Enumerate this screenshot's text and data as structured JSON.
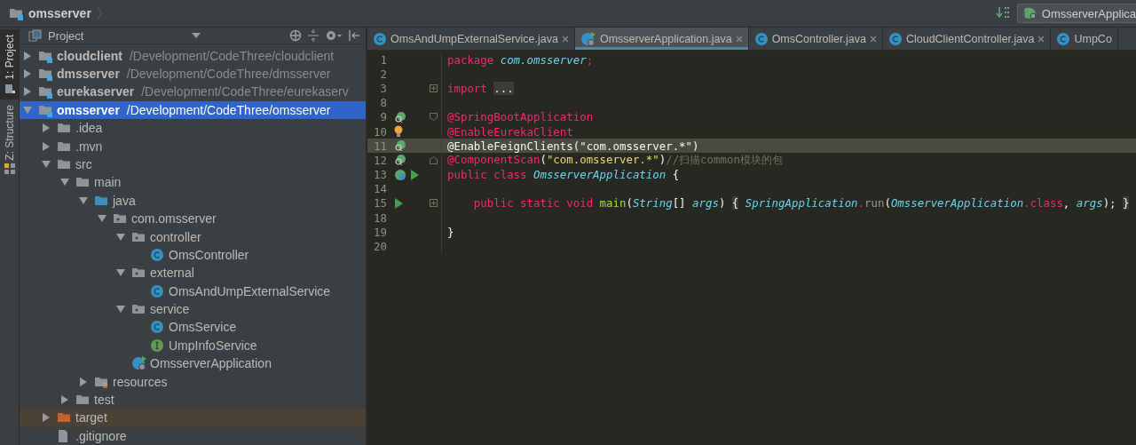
{
  "breadcrumb": {
    "label": "omsserver"
  },
  "toolbar": {
    "run_config": "OmsserverApplica"
  },
  "tool_strip": [
    {
      "label": "1: Project",
      "selected": true
    },
    {
      "label": "Z: Structure",
      "selected": false
    }
  ],
  "project_panel": {
    "title": "Project",
    "tree": [
      {
        "name": "cloudclient",
        "path": "/Development/CodeThree/cloudclient",
        "kind": "module",
        "expanded": false,
        "selected": false,
        "hovered": false
      },
      {
        "name": "dmsserver",
        "path": "/Development/CodeThree/dmsserver",
        "kind": "module",
        "expanded": false,
        "selected": false,
        "hovered": false
      },
      {
        "name": "eurekaserver",
        "path": "/Development/CodeThree/eurekaserv",
        "kind": "module",
        "expanded": false,
        "selected": false,
        "hovered": false
      },
      {
        "name": "omsserver",
        "path": "/Development/CodeThree/omsserver",
        "kind": "module",
        "expanded": true,
        "selected": true,
        "hovered": false,
        "children": [
          {
            "name": ".idea",
            "kind": "folder",
            "expanded": false,
            "selected": false,
            "hovered": false
          },
          {
            "name": ".mvn",
            "kind": "folder",
            "expanded": false,
            "selected": false,
            "hovered": false
          },
          {
            "name": "src",
            "kind": "folder",
            "expanded": true,
            "selected": false,
            "hovered": false,
            "children": [
              {
                "name": "main",
                "kind": "folder",
                "expanded": true,
                "selected": false,
                "hovered": false,
                "children": [
                  {
                    "name": "java",
                    "kind": "source",
                    "expanded": true,
                    "selected": false,
                    "hovered": false,
                    "children": [
                      {
                        "name": "com.omsserver",
                        "kind": "package",
                        "expanded": true,
                        "selected": false,
                        "hovered": false,
                        "children": [
                          {
                            "name": "controller",
                            "kind": "package",
                            "expanded": true,
                            "selected": false,
                            "hovered": false,
                            "children": [
                              {
                                "name": "OmsController",
                                "kind": "class",
                                "selected": false,
                                "hovered": false
                              }
                            ]
                          },
                          {
                            "name": "external",
                            "kind": "package",
                            "expanded": true,
                            "selected": false,
                            "hovered": false,
                            "children": [
                              {
                                "name": "OmsAndUmpExternalService",
                                "kind": "class",
                                "selected": false,
                                "hovered": false
                              }
                            ]
                          },
                          {
                            "name": "service",
                            "kind": "package",
                            "expanded": true,
                            "selected": false,
                            "hovered": false,
                            "children": [
                              {
                                "name": "OmsService",
                                "kind": "class",
                                "selected": false,
                                "hovered": false
                              },
                              {
                                "name": "UmpInfoService",
                                "kind": "interface",
                                "selected": false,
                                "hovered": false
                              }
                            ]
                          },
                          {
                            "name": "OmsserverApplication",
                            "kind": "spring",
                            "selected": false,
                            "hovered": false
                          }
                        ]
                      }
                    ]
                  },
                  {
                    "name": "resources",
                    "kind": "resources",
                    "expanded": false,
                    "selected": false,
                    "hovered": false
                  }
                ]
              },
              {
                "name": "test",
                "kind": "folder",
                "expanded": false,
                "selected": false,
                "hovered": false
              }
            ]
          },
          {
            "name": "target",
            "kind": "excluded",
            "expanded": false,
            "selected": false,
            "hovered": true
          },
          {
            "name": ".gitignore",
            "kind": "file",
            "selected": false,
            "hovered": false
          }
        ]
      }
    ]
  },
  "editor": {
    "tabs": [
      {
        "label": "OmsAndUmpExternalService.java",
        "kind": "class",
        "selected": false
      },
      {
        "label": "OmsserverApplication.java",
        "kind": "spring",
        "selected": true
      },
      {
        "label": "OmsController.java",
        "kind": "class",
        "selected": false
      },
      {
        "label": "CloudClientController.java",
        "kind": "class",
        "selected": false
      },
      {
        "label": "UmpCo",
        "kind": "class",
        "selected": false
      }
    ],
    "lines": [
      {
        "number": "1",
        "current": false,
        "tokens": [
          {
            "text": "package ",
            "kind": "keyword"
          },
          {
            "text": "com.omsserver",
            "kind": "type"
          },
          {
            "text": ";",
            "kind": "keyword"
          }
        ]
      },
      {
        "number": "2",
        "current": false
      },
      {
        "number": "3",
        "current": false,
        "fold": {
          "kind": "collapsed"
        },
        "tokens": [
          {
            "text": "import ",
            "kind": "keyword"
          },
          {
            "text": "...",
            "kind": "folded"
          }
        ]
      },
      {
        "number": "8",
        "current": false
      },
      {
        "number": "9",
        "current": false,
        "fold": {
          "kind": "start"
        },
        "gutter": [
          {
            "kind": "bean"
          }
        ],
        "tokens": [
          {
            "text": "@SpringBootApplication",
            "kind": "keyword"
          }
        ]
      },
      {
        "number": "10",
        "current": false,
        "gutter": [
          {
            "kind": "bulb"
          }
        ],
        "tokens": [
          {
            "text": "@EnableEurekaClient",
            "kind": "keyword"
          }
        ]
      },
      {
        "number": "11",
        "current": true,
        "gutter": [
          {
            "kind": "bean"
          }
        ],
        "tokens": [
          {
            "text": "@EnableFeignClients(\"com.omsserver.*\")",
            "kind": "plain"
          }
        ]
      },
      {
        "number": "12",
        "current": false,
        "fold": {
          "kind": "end"
        },
        "gutter": [
          {
            "kind": "bean"
          }
        ],
        "tokens": [
          {
            "text": "@ComponentScan",
            "kind": "keyword"
          },
          {
            "text": "(",
            "kind": "plain"
          },
          {
            "text": "\"com.omsserver.*\"",
            "kind": "string"
          },
          {
            "text": ")",
            "kind": "plain"
          },
          {
            "text": "//扫描common模块的包",
            "kind": "comment"
          }
        ]
      },
      {
        "number": "13",
        "current": false,
        "gutter": [
          {
            "kind": "spring"
          },
          {
            "kind": "run"
          }
        ],
        "tokens": [
          {
            "text": "public class ",
            "kind": "keyword"
          },
          {
            "text": "OmsserverApplication",
            "kind": "type"
          },
          {
            "text": " {",
            "kind": "plain"
          }
        ]
      },
      {
        "number": "14",
        "current": false
      },
      {
        "number": "15",
        "current": false,
        "fold": {
          "kind": "collapsed"
        },
        "gutter": [
          {
            "kind": "run"
          }
        ],
        "tokens": [
          {
            "text": "    public static void ",
            "kind": "keyword"
          },
          {
            "text": "main",
            "kind": "method"
          },
          {
            "text": "(",
            "kind": "plain"
          },
          {
            "text": "String",
            "kind": "type"
          },
          {
            "text": "[] ",
            "kind": "plain"
          },
          {
            "text": "args",
            "kind": "type"
          },
          {
            "text": ") ",
            "kind": "plain"
          },
          {
            "text": "{",
            "kind": "folded"
          },
          {
            "text": " SpringApplication",
            "kind": "type"
          },
          {
            "text": ".",
            "kind": "keyword"
          },
          {
            "text": "run",
            "kind": "dim"
          },
          {
            "text": "(",
            "kind": "plain"
          },
          {
            "text": "OmsserverApplication",
            "kind": "type"
          },
          {
            "text": ".class",
            "kind": "keyword"
          },
          {
            "text": ", ",
            "kind": "plain"
          },
          {
            "text": "args",
            "kind": "type"
          },
          {
            "text": "); ",
            "kind": "plain"
          },
          {
            "text": "}",
            "kind": "folded"
          }
        ]
      },
      {
        "number": "18",
        "current": false
      },
      {
        "number": "19",
        "current": false,
        "tokens": [
          {
            "text": "}",
            "kind": "plain"
          }
        ]
      },
      {
        "number": "20",
        "current": false
      }
    ]
  }
}
